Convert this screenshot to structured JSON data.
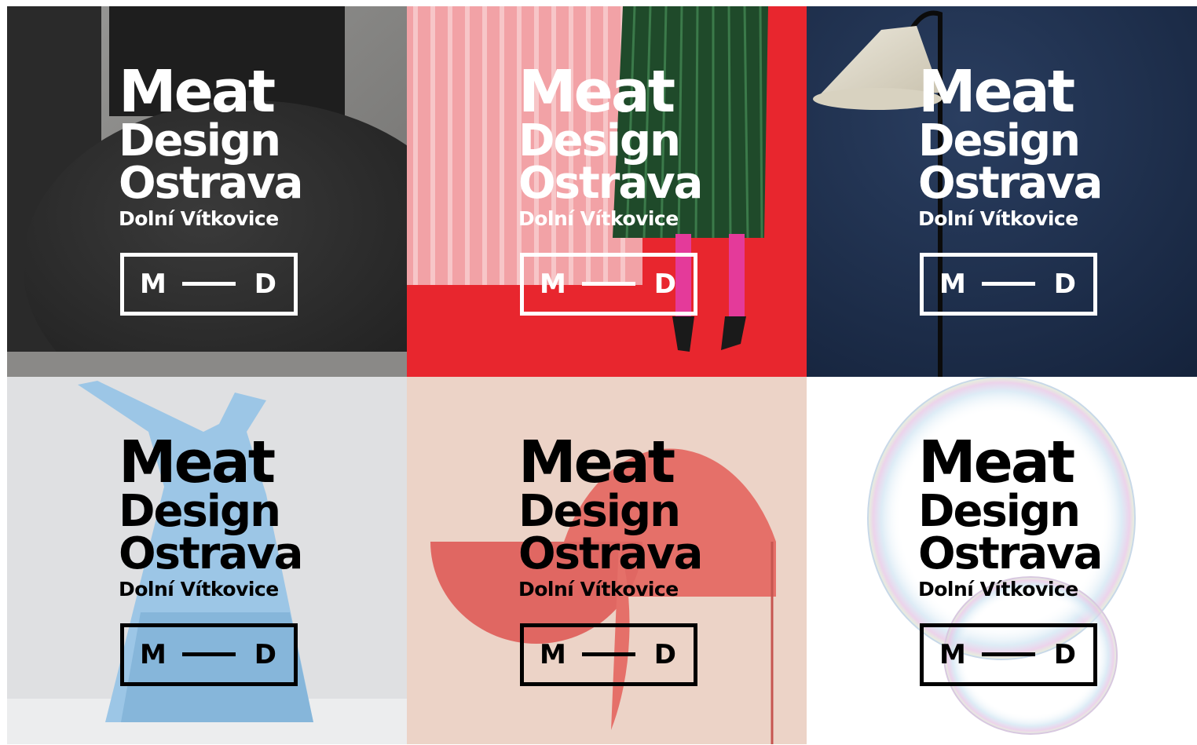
{
  "tiles": [
    {
      "line1": "Meat",
      "line2": "Design",
      "line3": "Ostrava",
      "line4": "Dolní Vítkovice",
      "box_left": "M",
      "box_right": "D",
      "text_color": "#ffffff",
      "background": "black tables on concrete"
    },
    {
      "line1": "Meat",
      "line2": "Design",
      "line3": "Ostrava",
      "line4": "Dolní Vítkovice",
      "box_left": "M",
      "box_right": "D",
      "text_color": "#ffffff",
      "background": "green pleated skirt on red"
    },
    {
      "line1": "Meat",
      "line2": "Design",
      "line3": "Ostrava",
      "line4": "Dolní Vítkovice",
      "box_left": "M",
      "box_right": "D",
      "text_color": "#ffffff",
      "background": "floor lamp on navy"
    },
    {
      "line1": "Meat",
      "line2": "Design",
      "line3": "Ostrava",
      "line4": "Dolní Vítkovice",
      "box_left": "M",
      "box_right": "D",
      "text_color": "#000000",
      "background": "light blue jug on grey"
    },
    {
      "line1": "Meat",
      "line2": "Design",
      "line3": "Ostrava",
      "line4": "Dolní Vítkovice",
      "box_left": "M",
      "box_right": "D",
      "text_color": "#000000",
      "background": "coral semicircle chair on beige"
    },
    {
      "line1": "Meat",
      "line2": "Design",
      "line3": "Ostrava",
      "line4": "Dolní Vítkovice",
      "box_left": "M",
      "box_right": "D",
      "text_color": "#000000",
      "background": "soap bubble on white"
    }
  ],
  "colors": {
    "red": "#e8262e",
    "navy": "#1b2d4c",
    "coral": "#e57069",
    "beige": "#ecd3c7",
    "light_blue": "#9cc6e6",
    "grey": "#dfe0e2"
  }
}
